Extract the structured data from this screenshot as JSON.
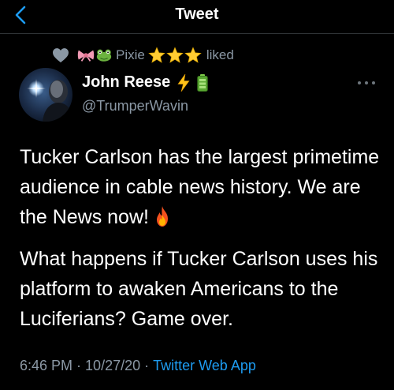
{
  "header": {
    "title": "Tweet",
    "back_icon": "chevron-left-icon"
  },
  "social_context": {
    "icons": [
      "heart-icon",
      "bow-icon",
      "frog-icon",
      "star-icon",
      "star-icon",
      "star-icon"
    ],
    "name": "Pixie",
    "action": "liked"
  },
  "author": {
    "display_name": "John Reese",
    "emoji_icons": [
      "lightning-bolt-icon",
      "battery-icon"
    ],
    "handle": "@TrumperWavin"
  },
  "tweet": {
    "paragraph_1": "Tucker Carlson has the largest primetime audience in cable news history. We are the News now!",
    "paragraph_1_icon": "fire-icon",
    "paragraph_2": "What happens if Tucker Carlson uses his platform to awaken Americans to the Luciferians? Game over.",
    "time": "6:46 PM",
    "date": "10/27/20",
    "separator": "·",
    "source": "Twitter Web App"
  },
  "colors": {
    "background": "#000000",
    "text": "#ffffff",
    "secondary_text": "#8b98a5",
    "accent": "#1d9bf0"
  }
}
